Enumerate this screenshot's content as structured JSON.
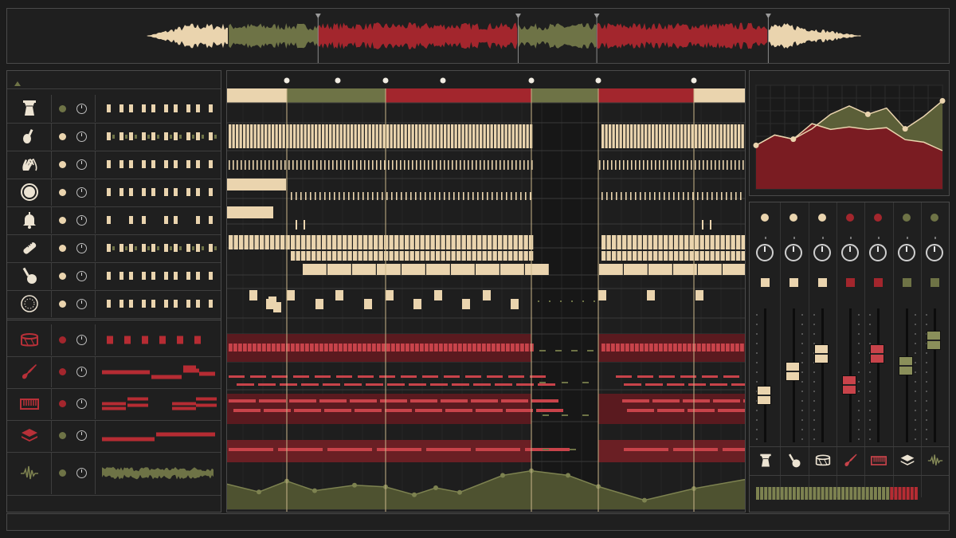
{
  "colors": {
    "background": "#1c1c1c",
    "panel_border": "#4a4a4a",
    "cream": "#ead4ae",
    "olive": "#6e7346",
    "red": "#a3262d",
    "playhead_line": "#c9b68a"
  },
  "overview": {
    "sections": [
      {
        "color": "cream",
        "from": 0.0,
        "to": 0.115
      },
      {
        "color": "olive",
        "from": 0.115,
        "to": 0.24
      },
      {
        "color": "red",
        "from": 0.24,
        "to": 0.52
      },
      {
        "color": "olive",
        "from": 0.52,
        "to": 0.63
      },
      {
        "color": "red",
        "from": 0.63,
        "to": 0.87
      },
      {
        "color": "cream",
        "from": 0.87,
        "to": 1.0
      }
    ],
    "marker_count": 4
  },
  "tracklist": {
    "collapse_icon": "triangle-up-icon",
    "tracks": [
      {
        "icon": "djembe-icon",
        "led": "olive",
        "group": "percussion"
      },
      {
        "icon": "shaker-icon",
        "led": "cream",
        "group": "percussion"
      },
      {
        "icon": "clap-hands-icon",
        "led": "cream",
        "group": "percussion"
      },
      {
        "icon": "tambourine-icon",
        "led": "cream",
        "group": "percussion"
      },
      {
        "icon": "bell-icon",
        "led": "cream",
        "group": "percussion"
      },
      {
        "icon": "guiro-icon",
        "led": "cream",
        "group": "percussion"
      },
      {
        "icon": "maraca-icon",
        "led": "cream",
        "group": "percussion"
      },
      {
        "icon": "tambourine-ring-icon",
        "led": "cream",
        "group": "percussion"
      },
      {
        "icon": "snare-drum-icon",
        "led": "red",
        "group": "instruments"
      },
      {
        "icon": "electric-guitar-icon",
        "led": "red",
        "group": "instruments"
      },
      {
        "icon": "keyboard-icon",
        "led": "red",
        "group": "instruments"
      },
      {
        "icon": "layers-icon",
        "led": "olive",
        "group": "instruments"
      },
      {
        "icon": "waveform-icon",
        "led": "olive",
        "group": "instruments"
      }
    ]
  },
  "arrangement": {
    "section_header": [
      "cream",
      "olive",
      "red",
      "olive",
      "red",
      "cream"
    ],
    "marker_count": 8,
    "automation_points": [
      0.61,
      0.42,
      0.68,
      0.45,
      0.58,
      0.54,
      0.35,
      0.52,
      0.41,
      0.82,
      0.93,
      0.82,
      0.55,
      0.22,
      0.5,
      0.72
    ]
  },
  "automation": {
    "red_curve": [
      0.42,
      0.52,
      0.48,
      0.63,
      0.7,
      0.73,
      0.7,
      0.72,
      0.58,
      0.55,
      0.45
    ],
    "olive_curve": [
      0.42,
      0.52,
      0.48,
      0.58,
      0.72,
      0.8,
      0.72,
      0.78,
      0.58,
      0.7,
      0.85
    ]
  },
  "mixer": {
    "channels": [
      {
        "led": "cream",
        "fader_color": "cream",
        "level": 0.35,
        "icon": "djembe-icon"
      },
      {
        "led": "cream",
        "fader_color": "cream",
        "level": 0.53,
        "icon": "maraca-icon"
      },
      {
        "led": "cream",
        "fader_color": "cream",
        "level": 0.66,
        "icon": "snare-drum-icon"
      },
      {
        "led": "red",
        "fader_color": "red",
        "level": 0.43,
        "icon": "electric-guitar-icon"
      },
      {
        "led": "red",
        "fader_color": "red",
        "level": 0.66,
        "icon": "keyboard-icon"
      },
      {
        "led": "olive",
        "fader_color": "olive",
        "level": 0.57,
        "icon": "layers-icon"
      },
      {
        "led": "olive",
        "fader_color": "olive",
        "level": 0.76,
        "icon": "waveform-icon"
      }
    ],
    "master_meter_level": 0.82
  }
}
